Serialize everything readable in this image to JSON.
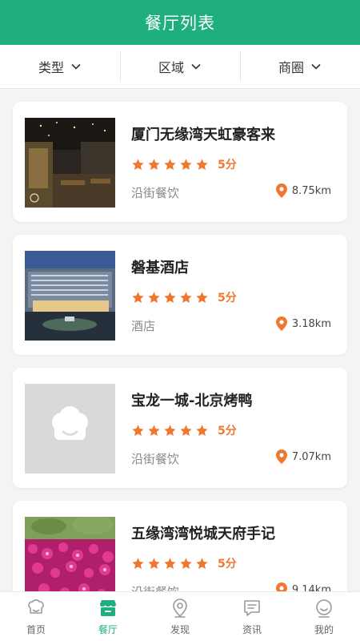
{
  "header": {
    "title": "餐厅列表"
  },
  "filters": [
    {
      "label": "类型"
    },
    {
      "label": "区域"
    },
    {
      "label": "商圈"
    }
  ],
  "restaurants": [
    {
      "name": "厦门无缘湾天虹豪客来",
      "stars": 5,
      "score": "5分",
      "category": "沿街餐饮",
      "distance": "8.75km",
      "image": "restaurant-interior-photo"
    },
    {
      "name": "磐基酒店",
      "stars": 5,
      "score": "5分",
      "category": "酒店",
      "distance": "3.18km",
      "image": "hotel-exterior-dusk-photo"
    },
    {
      "name": "宝龙一城-北京烤鸭",
      "stars": 5,
      "score": "5分",
      "category": "沿街餐饮",
      "distance": "7.07km",
      "image": "chef-hat-placeholder"
    },
    {
      "name": "五缘湾湾悦城天府手记",
      "stars": 5,
      "score": "5分",
      "category": "沿街餐饮",
      "distance": "9.14km",
      "image": "pink-flowers-photo"
    }
  ],
  "tabs": [
    {
      "label": "首页",
      "icon": "home-chef-hat-icon",
      "active": false
    },
    {
      "label": "餐厅",
      "icon": "restaurant-store-icon",
      "active": true
    },
    {
      "label": "发现",
      "icon": "location-pin-icon",
      "active": false
    },
    {
      "label": "资讯",
      "icon": "news-message-icon",
      "active": false
    },
    {
      "label": "我的",
      "icon": "profile-smiley-icon",
      "active": false
    }
  ],
  "colors": {
    "brand": "#1fae7e",
    "accent": "#f0772f",
    "placeholder": "#d9d9d9"
  }
}
